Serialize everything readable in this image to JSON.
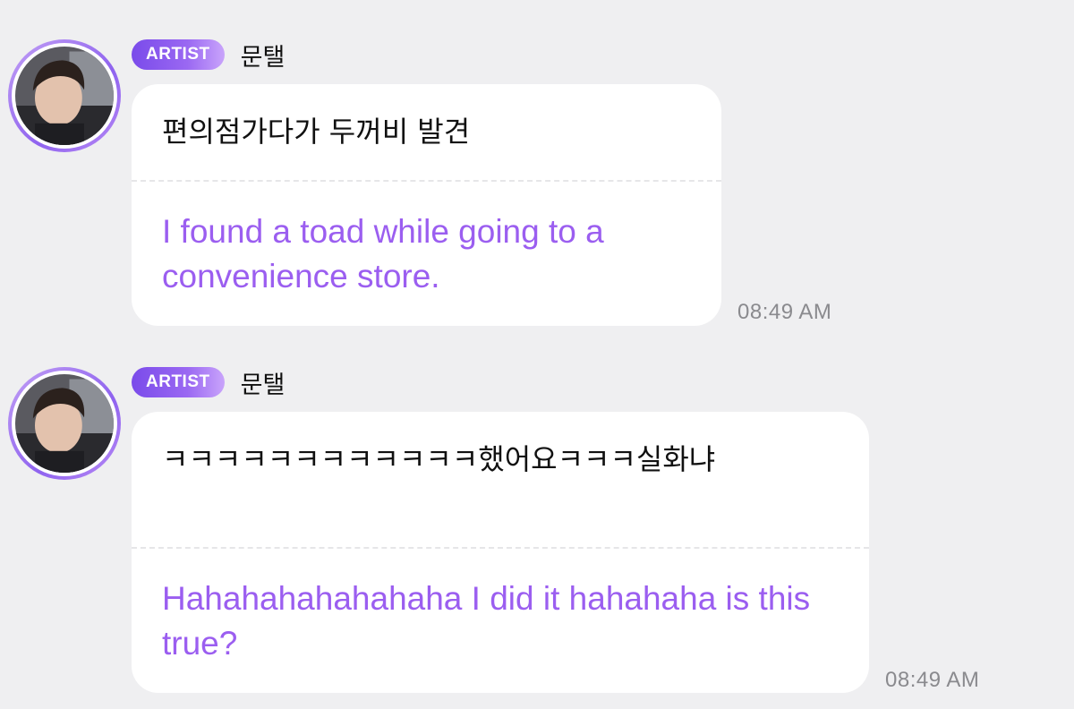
{
  "messages": [
    {
      "badge": "ARTIST",
      "sender": "문탤",
      "original": "편의점가다가 두꺼비 발견",
      "translation": "I found a toad while going to a convenience store.",
      "time": "08:49 AM"
    },
    {
      "badge": "ARTIST",
      "sender": "문탤",
      "original": "ㅋㅋㅋㅋㅋㅋㅋㅋㅋㅋㅋㅋ했어요ㅋㅋㅋ실화냐",
      "translation": "Hahahahahahahaha I did it hahahaha is this true?",
      "time": "08:49 AM"
    }
  ],
  "colors": {
    "background": "#efeff1",
    "translation_text": "#9b5ef0",
    "badge_start": "#7a4bea",
    "badge_end": "#c9a4fb",
    "timestamp": "#8a8a8e"
  },
  "icons": {
    "avatar": "profile-photo"
  }
}
